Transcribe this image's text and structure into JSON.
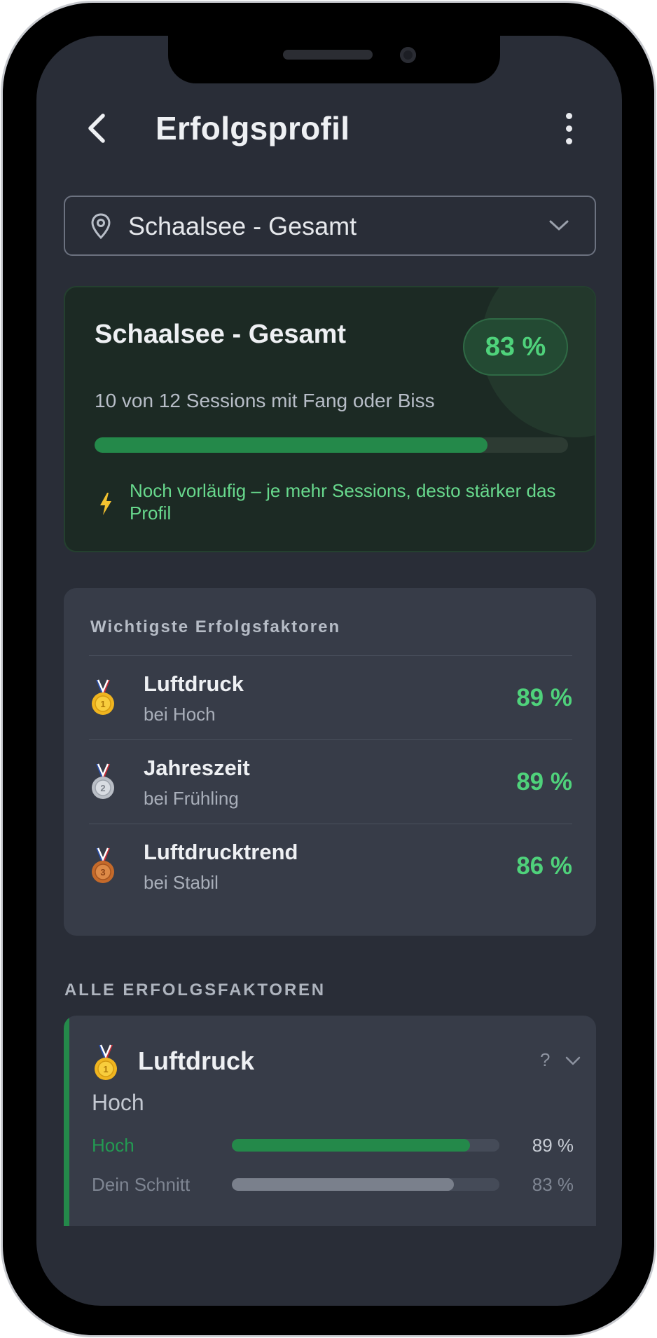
{
  "header": {
    "title": "Erfolgsprofil"
  },
  "location": {
    "selected": "Schaalsee - Gesamt"
  },
  "summary": {
    "name": "Schaalsee - Gesamt",
    "percent": "83 %",
    "percent_value": 0.83,
    "sessions_text": "10 von 12 Sessions mit Fang oder Biss",
    "note": "Noch vorläufig – je mehr Sessions, desto stärker das Profil"
  },
  "top_factors": {
    "heading": "Wichtigste Erfolgsfaktoren",
    "items": [
      {
        "medal": "gold-medal-icon",
        "name": "Luftdruck",
        "condition": "bei Hoch",
        "percent": "89 %"
      },
      {
        "medal": "silver-medal-icon",
        "name": "Jahreszeit",
        "condition": "bei Frühling",
        "percent": "89 %"
      },
      {
        "medal": "bronze-medal-icon",
        "name": "Luftdrucktrend",
        "condition": "bei Stabil",
        "percent": "86 %"
      }
    ]
  },
  "all_factors": {
    "heading": "ALLE ERFOLGSFAKTOREN",
    "cards": [
      {
        "name": "Luftdruck",
        "help": "?",
        "value": "Hoch",
        "comparison": [
          {
            "label": "Hoch",
            "percent": "89 %",
            "value": 0.89
          },
          {
            "label": "Dein Schnitt",
            "percent": "83 %",
            "value": 0.83
          }
        ]
      }
    ]
  },
  "colors": {
    "accent_green": "#24894a",
    "text_green": "#4fd27b",
    "background": "#292d37",
    "card": "#373c48"
  }
}
